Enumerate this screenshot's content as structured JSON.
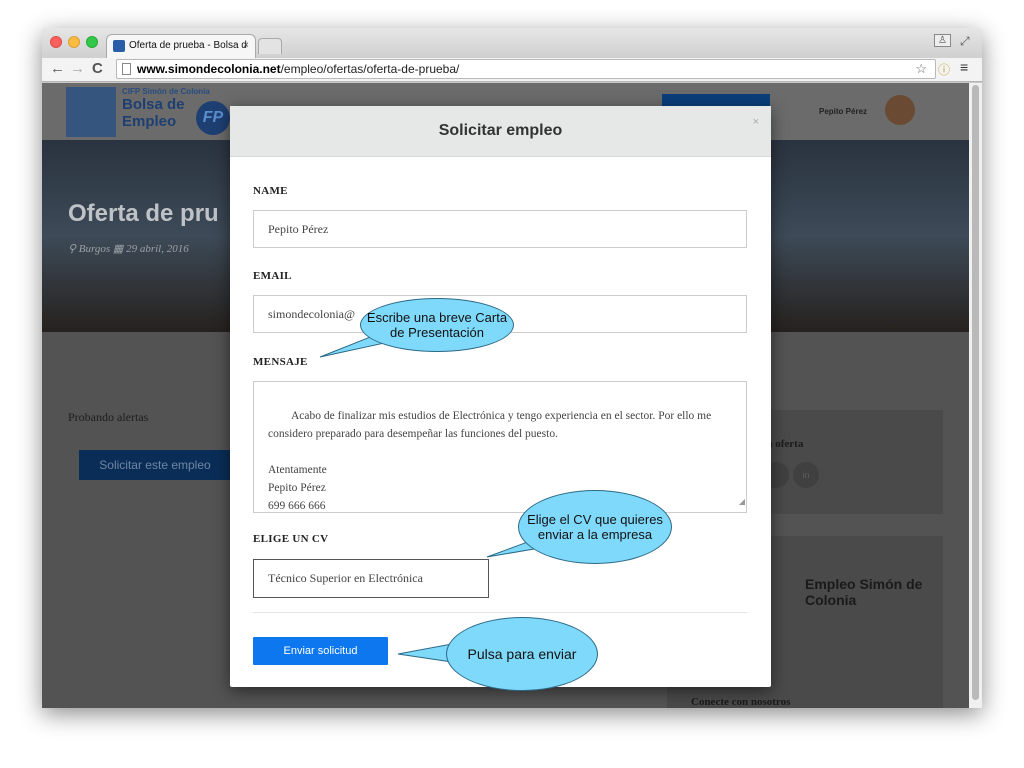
{
  "browser": {
    "tab_title": "Oferta de prueba - Bolsa d",
    "tab_close": "×",
    "url_host": "www.simondecolonia.net",
    "url_path": "/empleo/ofertas/oferta-de-prueba/",
    "back": "←",
    "forward": "→",
    "reload": "C",
    "star": "☆",
    "menu": "≡",
    "ext": "ⓘ"
  },
  "site": {
    "logo_small": "CIFP Simón de Colonia",
    "logo_line1": "Bolsa de",
    "logo_line2": "Empleo",
    "logo_fp": "FP",
    "user_name": "Pepito Pérez",
    "offer_title": "Oferta de pru",
    "offer_meta": "⚲ Burgos   ▦ 29 abril, 2016",
    "alert_text": "Probando alertas",
    "apply_button": "Solicitar este empleo",
    "share_text": "a oferta",
    "social_in": "in",
    "side_title": "Empleo Simón de Colonia",
    "side_footer": "Conecte con nosotros"
  },
  "modal": {
    "title": "Solicitar empleo",
    "close": "×",
    "name_label": "NAME",
    "name_value": "Pepito Pérez",
    "email_label": "EMAIL",
    "email_value": "simondecolonia@",
    "message_label": "MENSAJE",
    "message_value": "Acabo de finalizar mis estudios de Electrónica y tengo experiencia en el sector. Por ello me considero preparado para desempeñar las funciones del puesto.\n\nAtentamente\nPepito Pérez\n699 666 666",
    "cv_label": "ELIGE UN CV",
    "cv_value": "Técnico Superior en Electrónica",
    "send_button": "Enviar solicitud"
  },
  "callouts": {
    "letter": "Escribe una breve Carta de Presentación",
    "cv": "Elige el CV que quieres enviar a la empresa",
    "send": "Pulsa para enviar"
  },
  "colors": {
    "primary_button": "#0d77f0",
    "callout_fill": "#7fd9fb",
    "modal_header": "#e6e8e8"
  }
}
